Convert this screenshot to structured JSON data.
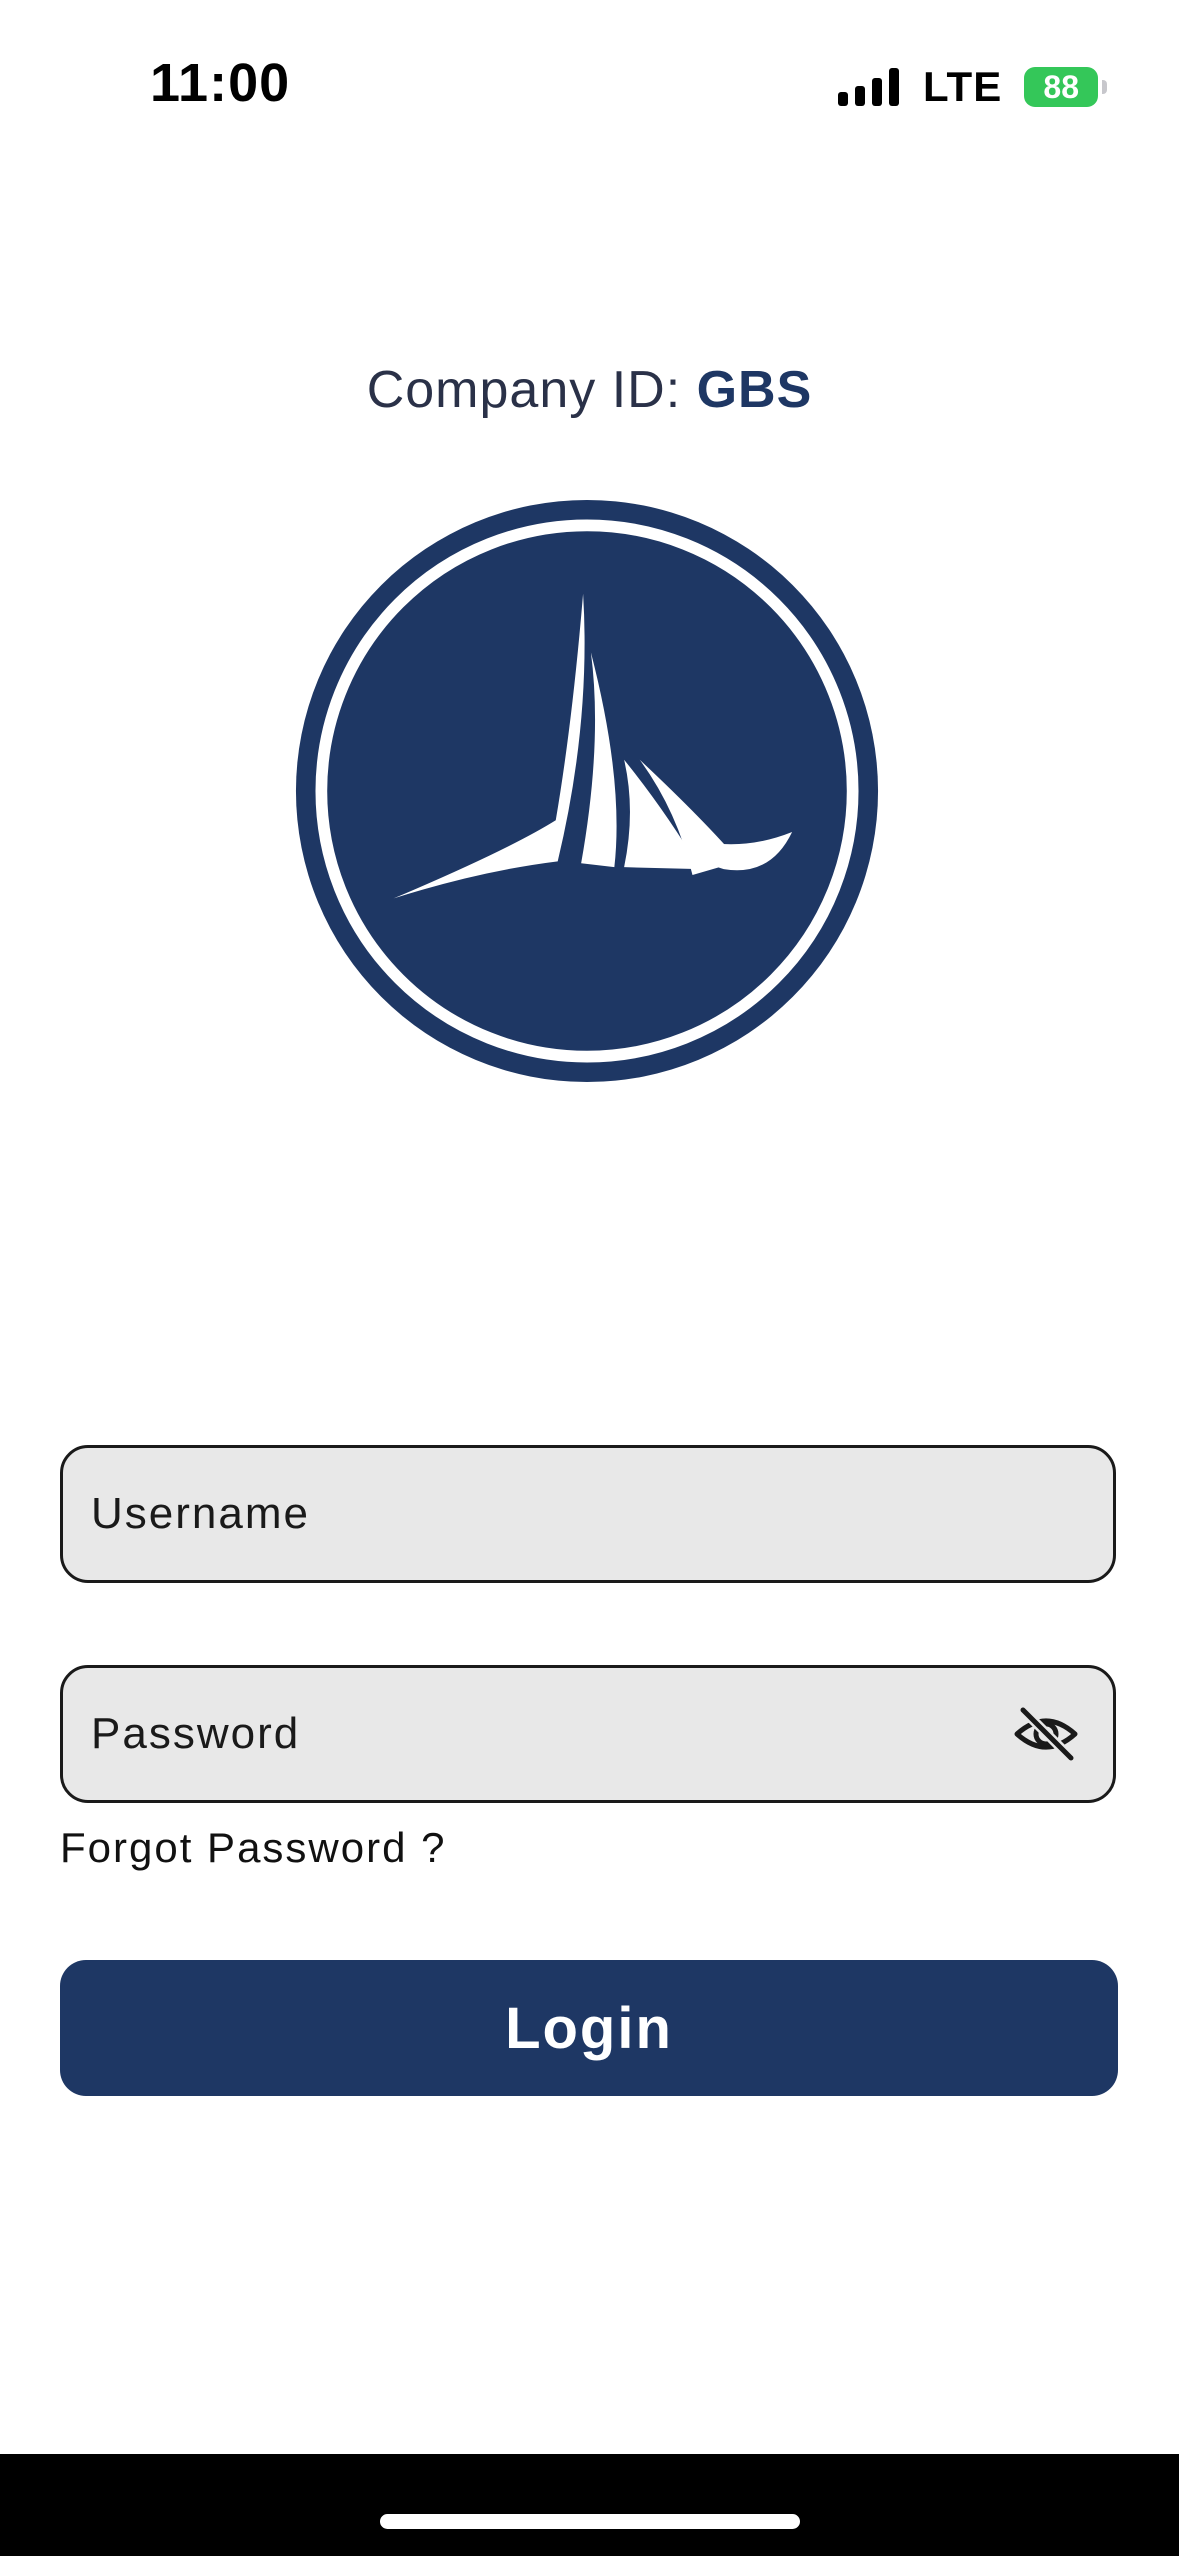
{
  "status_bar": {
    "time": "11:00",
    "network": "LTE",
    "battery": "88"
  },
  "company": {
    "label": "Company ID: ",
    "id": "GBS"
  },
  "logo": {
    "icon": "sailboat-logo",
    "color": "#1e3764"
  },
  "form": {
    "username_placeholder": "Username",
    "username_value": "",
    "password_placeholder": "Password",
    "password_value": "",
    "password_toggle_icon": "eye-slash-icon",
    "forgot_password": "Forgot Password ?",
    "login_label": "Login"
  },
  "colors": {
    "brand": "#1e3764",
    "field_bg": "#e8e8e8",
    "battery": "#34c759"
  }
}
